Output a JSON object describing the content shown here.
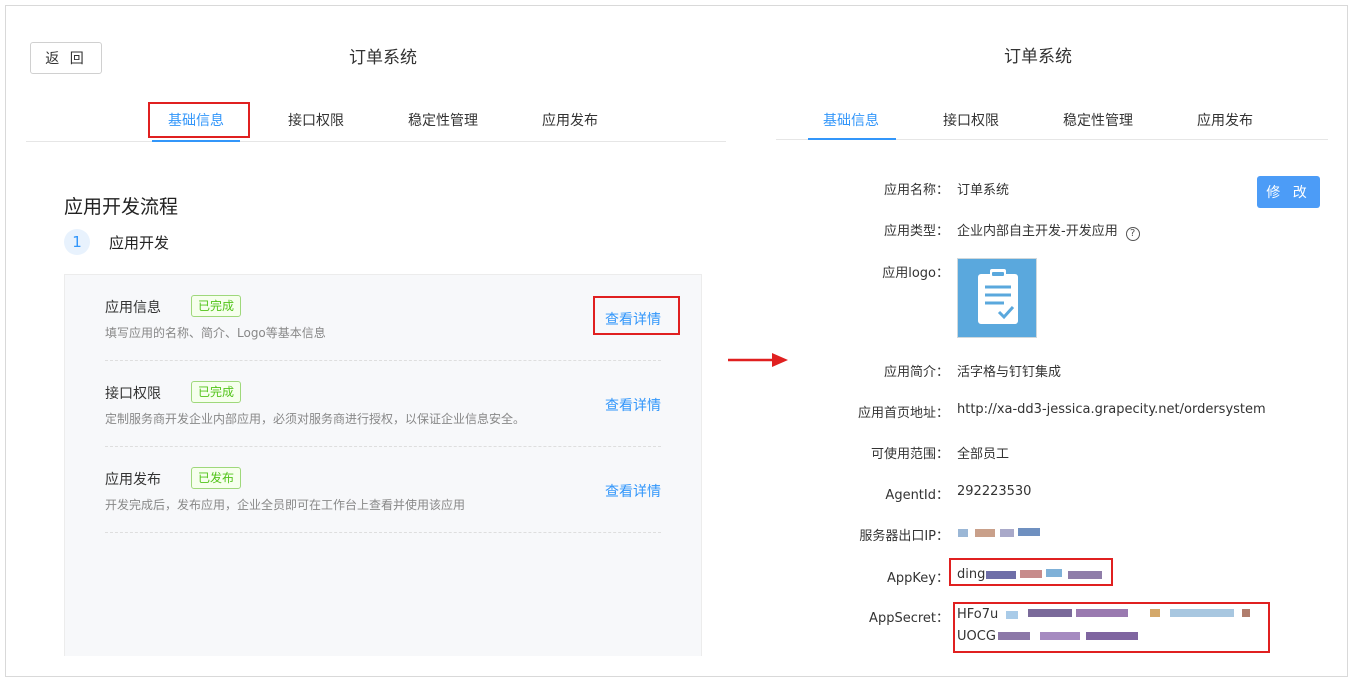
{
  "left": {
    "back_label": "返 回",
    "title": "订单系统",
    "tabs": [
      "基础信息",
      "接口权限",
      "稳定性管理",
      "应用发布"
    ],
    "flow_title": "应用开发流程",
    "step": {
      "number": "1",
      "label": "应用开发"
    },
    "rows": [
      {
        "title": "应用信息",
        "badge": "已完成",
        "desc": "填写应用的名称、简介、Logo等基本信息",
        "link": "查看详情"
      },
      {
        "title": "接口权限",
        "badge": "已完成",
        "desc": "定制服务商开发企业内部应用，必须对服务商进行授权，以保证企业信息安全。",
        "link": "查看详情"
      },
      {
        "title": "应用发布",
        "badge": "已发布",
        "desc": "开发完成后，发布应用，企业全员即可在工作台上查看并使用该应用",
        "link": "查看详情"
      }
    ]
  },
  "right": {
    "title": "订单系统",
    "tabs": [
      "基础信息",
      "接口权限",
      "稳定性管理",
      "应用发布"
    ],
    "edit_label": "修 改",
    "fields": {
      "name_label": "应用名称：",
      "name_value": "订单系统",
      "type_label": "应用类型：",
      "type_value": "企业内部自主开发-开发应用",
      "type_help": "?",
      "logo_label": "应用logo：",
      "intro_label": "应用简介：",
      "intro_value": "活字格与钉钉集成",
      "home_label": "应用首页地址：",
      "home_value": "http://xa-dd3-jessica.grapecity.net/ordersystem",
      "scope_label": "可使用范围：",
      "scope_value": "全部员工",
      "agent_label": "AgentId：",
      "agent_value": "292223530",
      "ip_label": "服务器出口IP：",
      "appkey_label": "AppKey：",
      "appkey_prefix": "ding",
      "appsecret_label": "AppSecret：",
      "appsecret_line1": "HFo7u",
      "appsecret_line2": "UOCG"
    }
  },
  "colors": {
    "accent": "#3296fa",
    "highlight": "#e02020",
    "success": "#52c41a"
  }
}
